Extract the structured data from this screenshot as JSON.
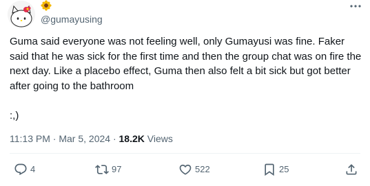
{
  "tweet": {
    "handle": "@gumayusing",
    "text": "Guma said everyone was not feeling well, only Gumayusi was fine. Faker said that he was sick for the first time and then the group chat was on fire the next day. Like a placebo effect, Guma then also felt a bit sick but got better after going to the bathroom\n\n:,)",
    "time": "11:13 PM",
    "date": "Mar 5, 2024",
    "separator": "·",
    "views_count": "18.2K",
    "views_label": "Views"
  },
  "actions": {
    "replies": "4",
    "reposts": "97",
    "likes": "522",
    "bookmarks": "25"
  },
  "icons": {
    "more": "more-horizontal-icon",
    "reply": "reply-icon",
    "repost": "repost-icon",
    "like": "heart-icon",
    "bookmark": "bookmark-icon",
    "share": "share-icon",
    "badge": "sunflower-emoji-icon"
  },
  "colors": {
    "text_primary": "#0f1419",
    "text_secondary": "#536471",
    "divider": "#eff3f4"
  }
}
